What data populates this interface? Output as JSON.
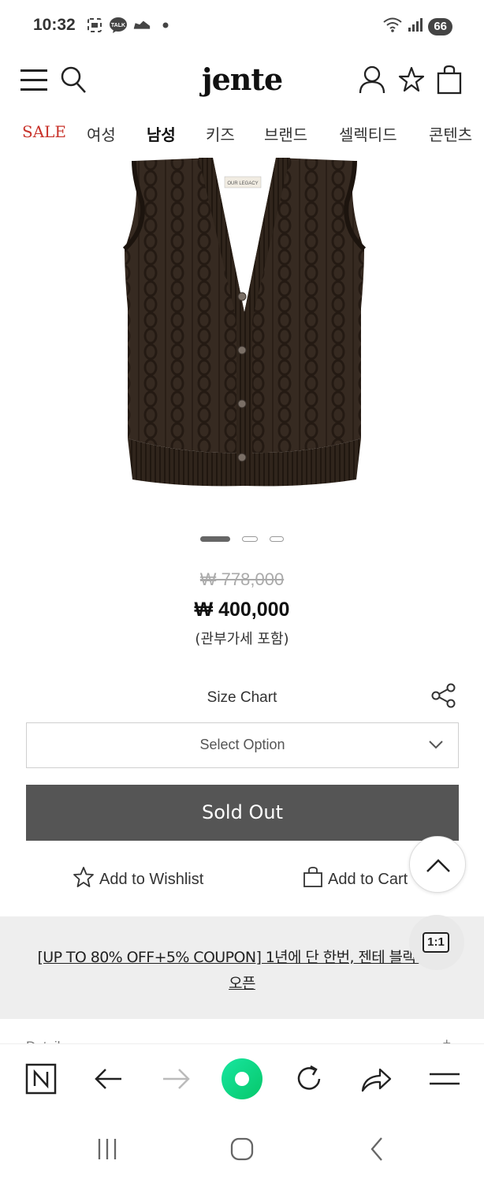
{
  "status_bar": {
    "time": "10:32",
    "talk_badge": "TALK",
    "battery": "66"
  },
  "header": {
    "logo": "jente"
  },
  "categories": [
    {
      "label": "SALE"
    },
    {
      "label": "여성"
    },
    {
      "label": "남성"
    },
    {
      "label": "키즈"
    },
    {
      "label": "브랜드"
    },
    {
      "label": "셀렉티드"
    },
    {
      "label": "콘텐츠"
    }
  ],
  "product": {
    "image_alt": "Brown cable-knit button vest",
    "label_tag": "OUR LEGACY",
    "carousel": {
      "count": 3,
      "active": 1
    },
    "original_price": "₩ 778,000",
    "price": "₩ 400,000",
    "tax_note": "(관부가세 포함)"
  },
  "size_chart_label": "Size Chart",
  "select": {
    "label": "Select Option"
  },
  "soldout_label": "Sold Out",
  "actions": {
    "wishlist": "Add to Wishlist",
    "cart": "Add to Cart"
  },
  "promo": {
    "line1": "[UP TO 80% OFF+5% COUPON] 1년에 단 한번, 젠테 블랙 위크",
    "line2": "오픈"
  },
  "chat_badge": "1:1",
  "details_peek": "Details",
  "colors": {
    "sale": "#c8322a",
    "soldout_bg": "#555555",
    "promo_bg": "#eeeeee",
    "browser_home": "#10d98a"
  }
}
